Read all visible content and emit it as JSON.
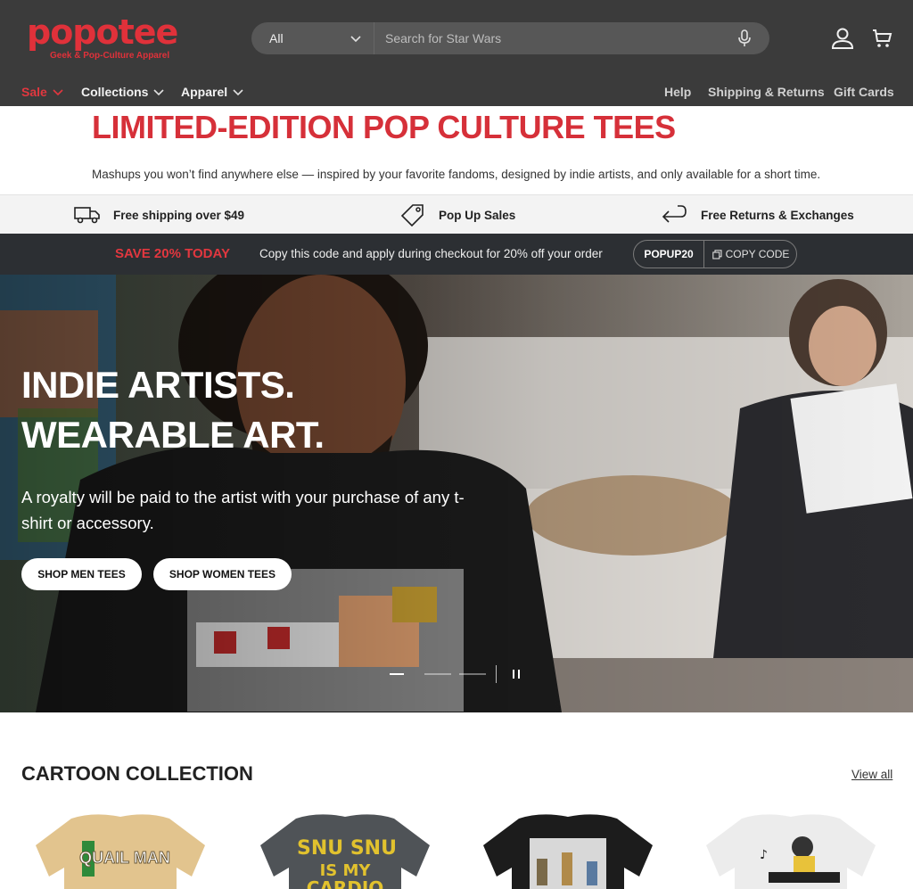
{
  "header": {
    "logo_text": "popotee",
    "logo_tagline": "Geek & Pop-Culture Apparel",
    "search": {
      "category": "All",
      "placeholder": "Search for Star Wars"
    },
    "nav": [
      {
        "label": "Sale"
      },
      {
        "label": "Collections"
      },
      {
        "label": "Apparel"
      }
    ],
    "utility_links": [
      "Help",
      "Shipping & Returns",
      "Gift Cards"
    ]
  },
  "intro": {
    "title": "LIMITED-EDITION POP CULTURE TEES",
    "description": "Mashups you won’t find anywhere else — inspired by your favorite fandoms, designed by indie artists, and only available for a short time."
  },
  "usp": [
    {
      "icon": "truck-icon",
      "label": "Free shipping over $49"
    },
    {
      "icon": "tag-icon",
      "label": "Pop Up Sales"
    },
    {
      "icon": "return-arrow-icon",
      "label": "Free Returns & Exchanges"
    }
  ],
  "promo": {
    "headline": "SAVE 20% TODAY",
    "text": "Copy this code and apply during checkout for 20% off your order",
    "code": "POPUP20",
    "copy_label": "COPY CODE"
  },
  "hero": {
    "heading_line1": "INDIE ARTISTS.",
    "heading_line2": "WEARABLE ART.",
    "subtext": "A royalty will be paid to the artist with your purchase of any t-shirt or accessory.",
    "buttons": [
      "SHOP MEN TEES",
      "SHOP WOMEN TEES"
    ],
    "slide_current": 1,
    "slide_total": 3
  },
  "collection": {
    "title": "CARTOON COLLECTION",
    "view_all": "View all",
    "products": [
      {
        "shirt_color": "#e2c48e",
        "print_text": "QUAIL MAN",
        "print_color": "#6b8a3a"
      },
      {
        "shirt_color": "#4f5357",
        "print_text_1": "SNU SNU",
        "print_text_2": "IS MY",
        "print_text_3": "CARDIO",
        "print_color": "#e2c22e"
      },
      {
        "shirt_color": "#1c1c1c",
        "print_text": "",
        "print_color": "#cccccc"
      },
      {
        "shirt_color": "#ececec",
        "print_text": "",
        "print_color": "#333333"
      }
    ]
  },
  "colors": {
    "brand_red": "#e0313a",
    "header_bg": "#3b3b3b",
    "promo_bg": "#2c2f33"
  }
}
